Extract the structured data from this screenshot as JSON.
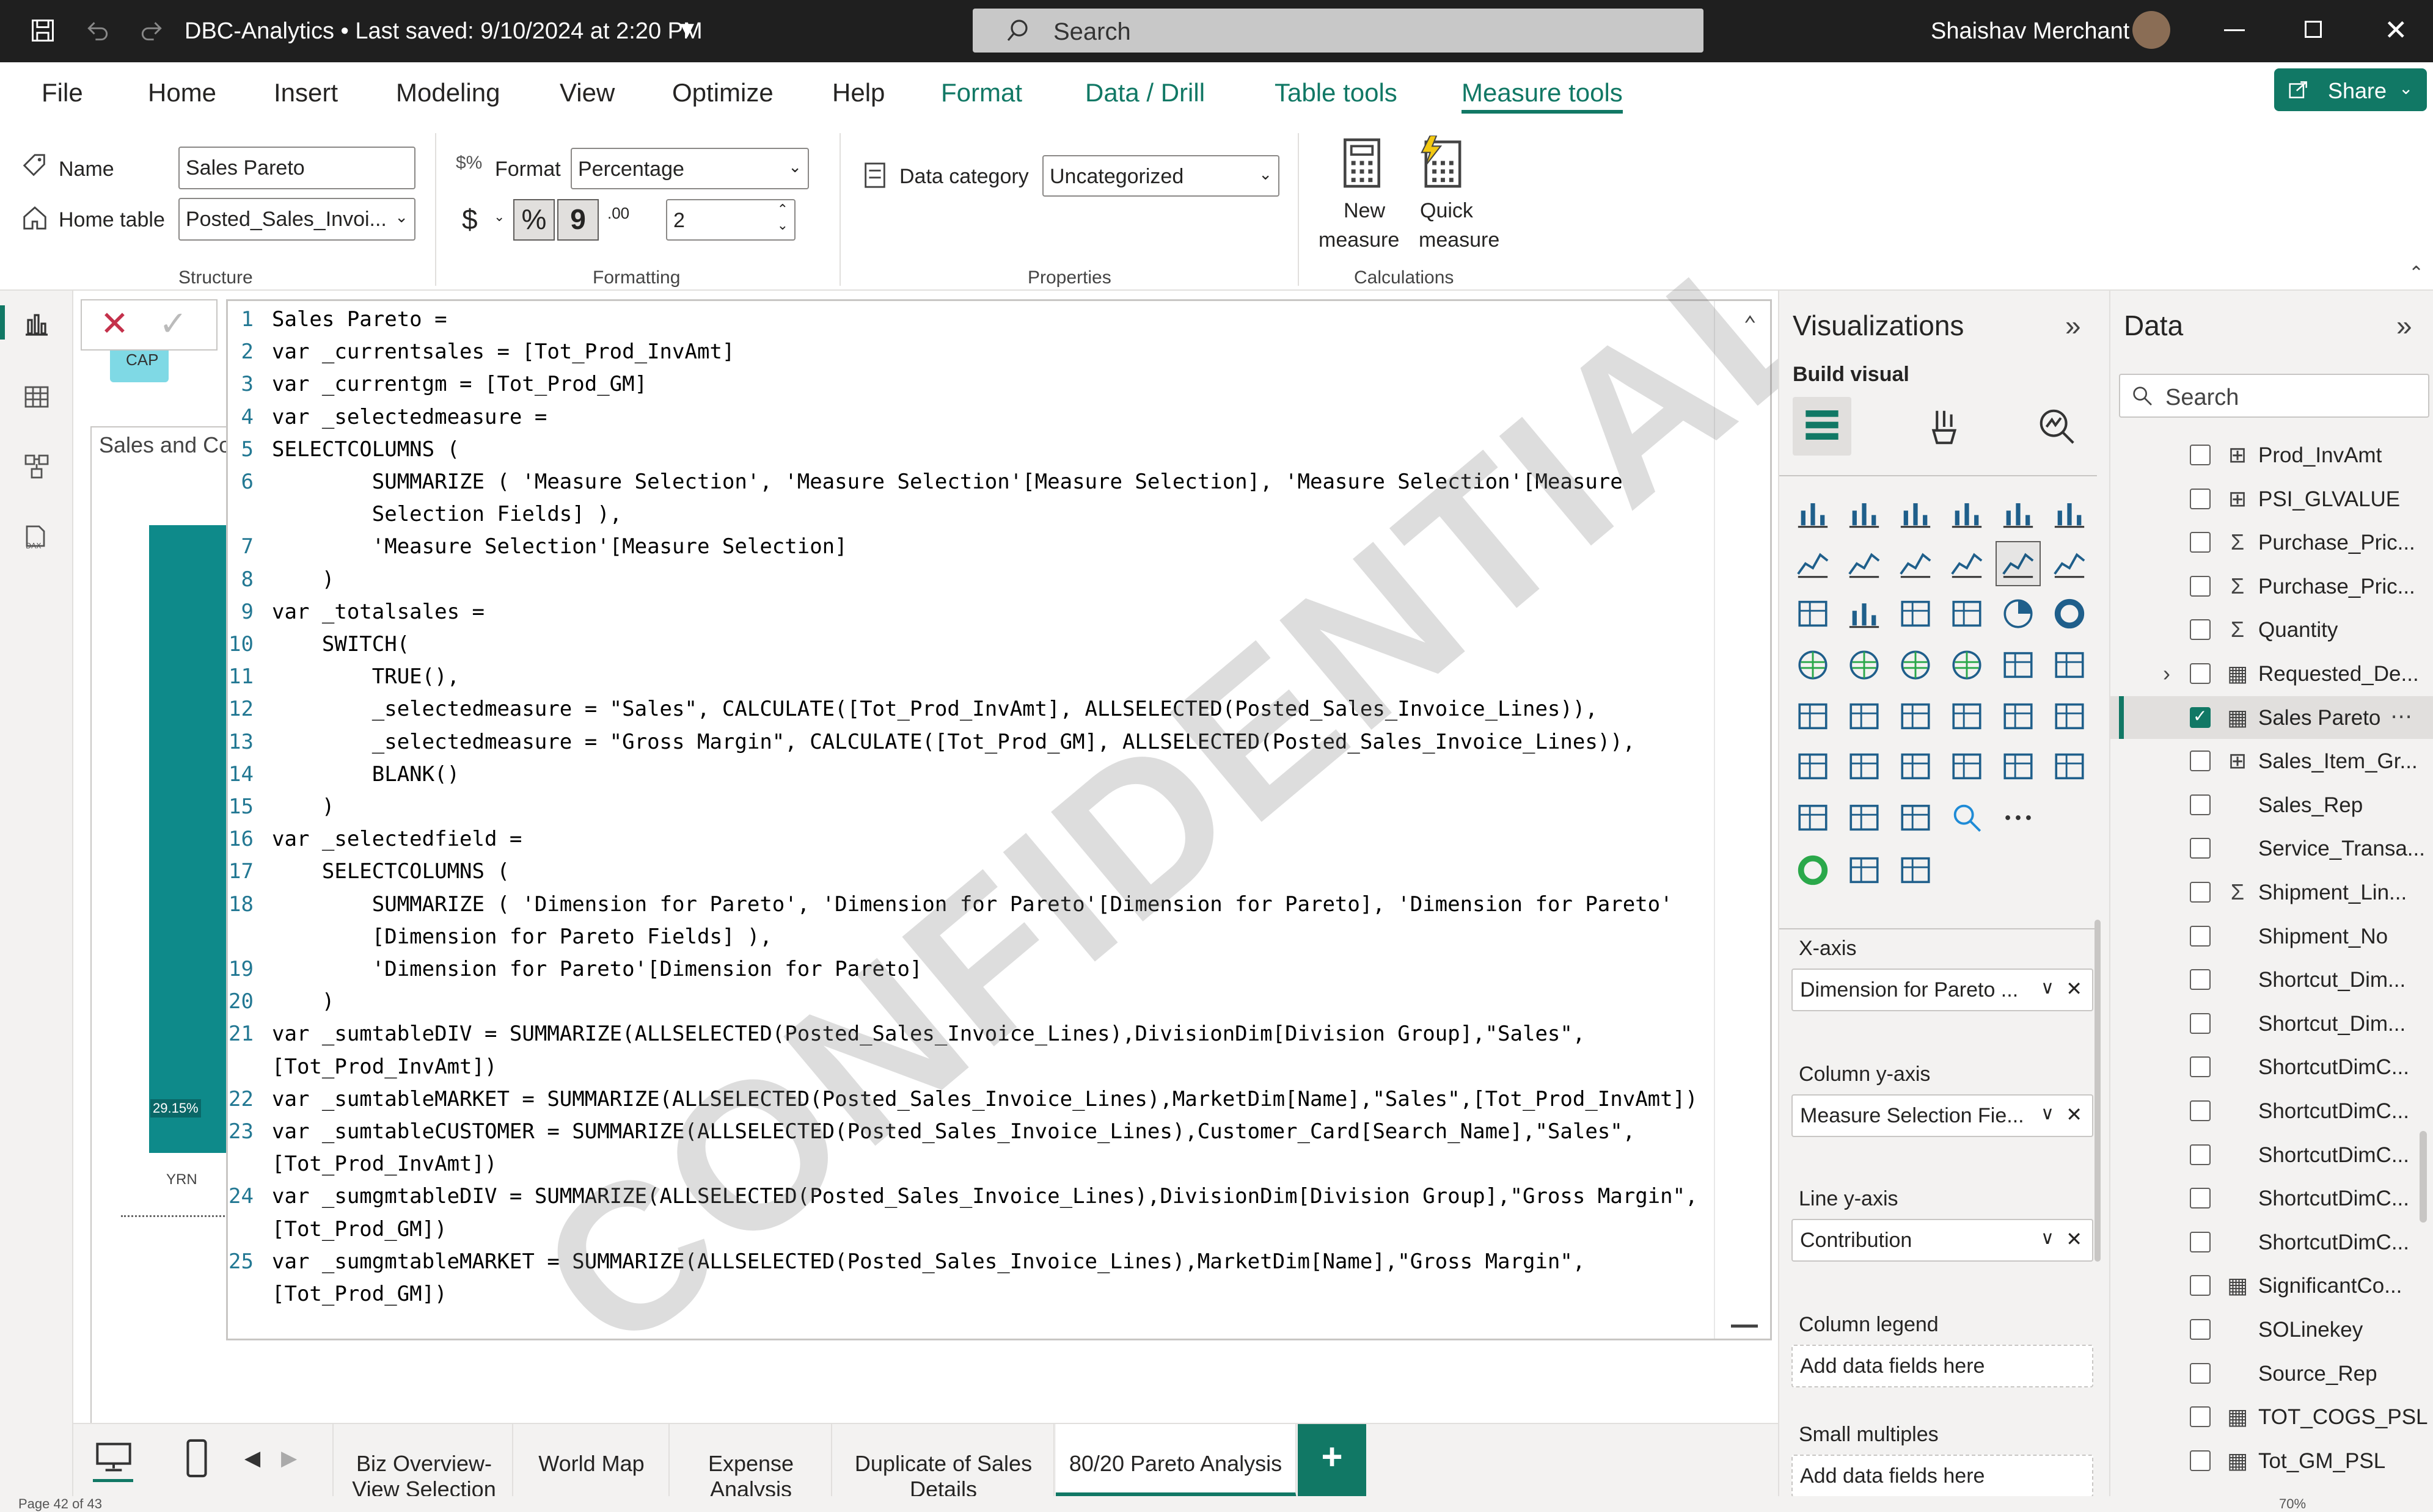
{
  "titlebar": {
    "doc_title": "DBC-Analytics • Last saved: 9/10/2024 at 2:20 PM",
    "search_placeholder": "Search",
    "user_name": "Shaishav Merchant"
  },
  "menu": {
    "items": [
      "File",
      "Home",
      "Insert",
      "Modeling",
      "View",
      "Optimize",
      "Help",
      "Format",
      "Data / Drill",
      "Table tools",
      "Measure tools"
    ],
    "active": "Measure tools",
    "share_label": "Share"
  },
  "ribbon": {
    "name_label": "Name",
    "name_value": "Sales Pareto",
    "home_table_label": "Home table",
    "home_table_value": "Posted_Sales_Invoi...",
    "structure_group": "Structure",
    "format_label": "Format",
    "format_value": "Percentage",
    "currency_symbol": "$",
    "percent_symbol": "%",
    "comma_symbol": "9",
    "decimal_symbol": ".00",
    "decimals_value": "2",
    "formatting_group": "Formatting",
    "data_category_label": "Data category",
    "data_category_value": "Uncategorized",
    "properties_group": "Properties",
    "new_measure_line1": "New",
    "new_measure_line2": "measure",
    "quick_measure_line1": "Quick",
    "quick_measure_line2": "measure",
    "calculations_group": "Calculations"
  },
  "canvas": {
    "visual_title": "Sales and Co",
    "cap_label": "CAP",
    "bar_label": "29.15%",
    "axis_label": "YRN"
  },
  "editor": {
    "lines": [
      {
        "n": "1",
        "t": "Sales Pareto ="
      },
      {
        "n": "2",
        "t": "var _currentsales = [Tot_Prod_InvAmt]"
      },
      {
        "n": "3",
        "t": "var _currentgm = [Tot_Prod_GM]"
      },
      {
        "n": "4",
        "t": "var _selectedmeasure ="
      },
      {
        "n": "5",
        "t": "SELECTCOLUMNS ("
      },
      {
        "n": "6",
        "t": "        SUMMARIZE ( 'Measure Selection', 'Measure Selection'[Measure Selection], 'Measure Selection'[Measure"
      },
      {
        "n": "",
        "t": "        Selection Fields] ),"
      },
      {
        "n": "7",
        "t": "        'Measure Selection'[Measure Selection]"
      },
      {
        "n": "8",
        "t": "    )"
      },
      {
        "n": "9",
        "t": "var _totalsales ="
      },
      {
        "n": "10",
        "t": "    SWITCH("
      },
      {
        "n": "11",
        "t": "        TRUE(),"
      },
      {
        "n": "12",
        "t": "        _selectedmeasure = \"Sales\", CALCULATE([Tot_Prod_InvAmt], ALLSELECTED(Posted_Sales_Invoice_Lines)),"
      },
      {
        "n": "13",
        "t": "        _selectedmeasure = \"Gross Margin\", CALCULATE([Tot_Prod_GM], ALLSELECTED(Posted_Sales_Invoice_Lines)),"
      },
      {
        "n": "14",
        "t": "        BLANK()"
      },
      {
        "n": "15",
        "t": "    )"
      },
      {
        "n": "16",
        "t": "var _selectedfield ="
      },
      {
        "n": "17",
        "t": "    SELECTCOLUMNS ("
      },
      {
        "n": "18",
        "t": "        SUMMARIZE ( 'Dimension for Pareto', 'Dimension for Pareto'[Dimension for Pareto], 'Dimension for Pareto'"
      },
      {
        "n": "",
        "t": "        [Dimension for Pareto Fields] ),"
      },
      {
        "n": "19",
        "t": "        'Dimension for Pareto'[Dimension for Pareto]"
      },
      {
        "n": "20",
        "t": "    )"
      },
      {
        "n": "21",
        "t": "var _sumtableDIV = SUMMARIZE(ALLSELECTED(Posted_Sales_Invoice_Lines),DivisionDim[Division Group],\"Sales\","
      },
      {
        "n": "",
        "t": "[Tot_Prod_InvAmt])"
      },
      {
        "n": "22",
        "t": "var _sumtableMARKET = SUMMARIZE(ALLSELECTED(Posted_Sales_Invoice_Lines),MarketDim[Name],\"Sales\",[Tot_Prod_InvAmt])"
      },
      {
        "n": "23",
        "t": "var _sumtableCUSTOMER = SUMMARIZE(ALLSELECTED(Posted_Sales_Invoice_Lines),Customer_Card[Search_Name],\"Sales\","
      },
      {
        "n": "",
        "t": "[Tot_Prod_InvAmt])"
      },
      {
        "n": "24",
        "t": "var _sumgmtableDIV = SUMMARIZE(ALLSELECTED(Posted_Sales_Invoice_Lines),DivisionDim[Division Group],\"Gross Margin\","
      },
      {
        "n": "",
        "t": "[Tot_Prod_GM])"
      },
      {
        "n": "25",
        "t": "var _sumgmtableMARKET = SUMMARIZE(ALLSELECTED(Posted_Sales_Invoice_Lines),MarketDim[Name],\"Gross Margin\","
      },
      {
        "n": "",
        "t": "[Tot_Prod_GM])"
      }
    ]
  },
  "watermark": "CONFIDENTIAL",
  "viz": {
    "title": "Visualizations",
    "build_visual": "Build visual",
    "wells": [
      {
        "title": "X-axis",
        "value": "Dimension for Pareto ...",
        "filled": true
      },
      {
        "title": "Column y-axis",
        "value": "Measure Selection Fie...",
        "filled": true
      },
      {
        "title": "Line y-axis",
        "value": "Contribution",
        "filled": true
      },
      {
        "title": "Column legend",
        "value": "Add data fields here",
        "filled": false
      },
      {
        "title": "Small multiples",
        "value": "Add data fields here",
        "filled": false
      }
    ]
  },
  "data": {
    "title": "Data",
    "search_placeholder": "Search",
    "fields": [
      {
        "label": "Prod_InvAmt",
        "icon": "calc-table-icon",
        "glyph": "⊞",
        "checked": false
      },
      {
        "label": "PSI_GLVALUE",
        "icon": "calc-table-icon",
        "glyph": "⊞",
        "checked": false
      },
      {
        "label": "Purchase_Pric...",
        "icon": "sigma-icon",
        "glyph": "Σ",
        "checked": false
      },
      {
        "label": "Purchase_Pric...",
        "icon": "sigma-icon",
        "glyph": "Σ",
        "checked": false
      },
      {
        "label": "Quantity",
        "icon": "sigma-icon",
        "glyph": "Σ",
        "checked": false
      },
      {
        "label": "Requested_De...",
        "icon": "calendar-icon",
        "glyph": "▦",
        "checked": false,
        "expand": true
      },
      {
        "label": "Sales Pareto",
        "icon": "measure-icon",
        "glyph": "▦",
        "checked": true,
        "more": "⋯"
      },
      {
        "label": "Sales_Item_Gr...",
        "icon": "calc-table-icon",
        "glyph": "⊞",
        "checked": false
      },
      {
        "label": "Sales_Rep",
        "icon": "",
        "glyph": "",
        "checked": false
      },
      {
        "label": "Service_Transa...",
        "icon": "",
        "glyph": "",
        "checked": false
      },
      {
        "label": "Shipment_Lin...",
        "icon": "sigma-icon",
        "glyph": "Σ",
        "checked": false
      },
      {
        "label": "Shipment_No",
        "icon": "",
        "glyph": "",
        "checked": false
      },
      {
        "label": "Shortcut_Dim...",
        "icon": "",
        "glyph": "",
        "checked": false
      },
      {
        "label": "Shortcut_Dim...",
        "icon": "",
        "glyph": "",
        "checked": false
      },
      {
        "label": "ShortcutDimC...",
        "icon": "",
        "glyph": "",
        "checked": false
      },
      {
        "label": "ShortcutDimC...",
        "icon": "",
        "glyph": "",
        "checked": false
      },
      {
        "label": "ShortcutDimC...",
        "icon": "",
        "glyph": "",
        "checked": false
      },
      {
        "label": "ShortcutDimC...",
        "icon": "",
        "glyph": "",
        "checked": false
      },
      {
        "label": "ShortcutDimC...",
        "icon": "",
        "glyph": "",
        "checked": false
      },
      {
        "label": "SignificantCo...",
        "icon": "measure-icon",
        "glyph": "▦",
        "checked": false
      },
      {
        "label": "SOLinekey",
        "icon": "",
        "glyph": "",
        "checked": false
      },
      {
        "label": "Source_Rep",
        "icon": "",
        "glyph": "",
        "checked": false
      },
      {
        "label": "TOT_COGS_PSL",
        "icon": "measure-icon",
        "glyph": "▦",
        "checked": false
      },
      {
        "label": "Tot_GM_PSL",
        "icon": "measure-icon",
        "glyph": "▦",
        "checked": false
      }
    ]
  },
  "pages": {
    "tabs": [
      "Biz Overview-View Selection",
      "World Map",
      "Expense Analysis",
      "Duplicate of Sales Details",
      "80/20 Pareto Analysis"
    ],
    "active": "80/20 Pareto Analysis",
    "add_label": "+"
  },
  "status": {
    "left": "Page 42 of 43",
    "zoom": "70%"
  },
  "colors": {
    "accent": "#117865",
    "titlebar": "#1f1f1f",
    "bar": "#0e8a8a"
  }
}
